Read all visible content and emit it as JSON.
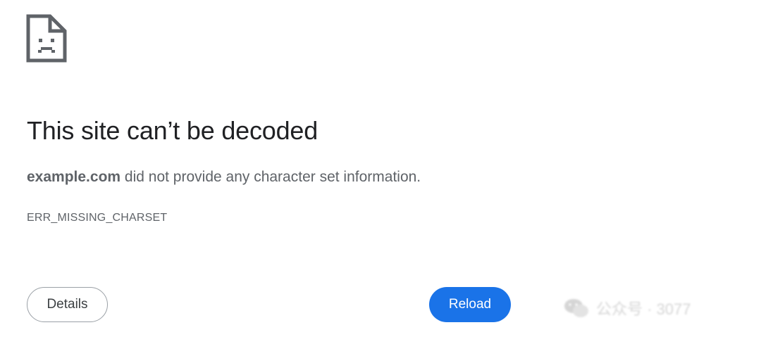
{
  "error_icon": "sad-page-icon",
  "title": "This site can’t be decoded",
  "description": {
    "host": "example.com",
    "message": " did not provide any character set information."
  },
  "error_code": "ERR_MISSING_CHARSET",
  "buttons": {
    "details_label": "Details",
    "reload_label": "Reload"
  },
  "watermark": {
    "icon": "wechat-icon",
    "text": "公众号 · 3077"
  },
  "colors": {
    "title": "#202124",
    "body_text": "#5f6368",
    "reload_bg": "#1a73e8",
    "details_border": "#9aa0a6"
  }
}
